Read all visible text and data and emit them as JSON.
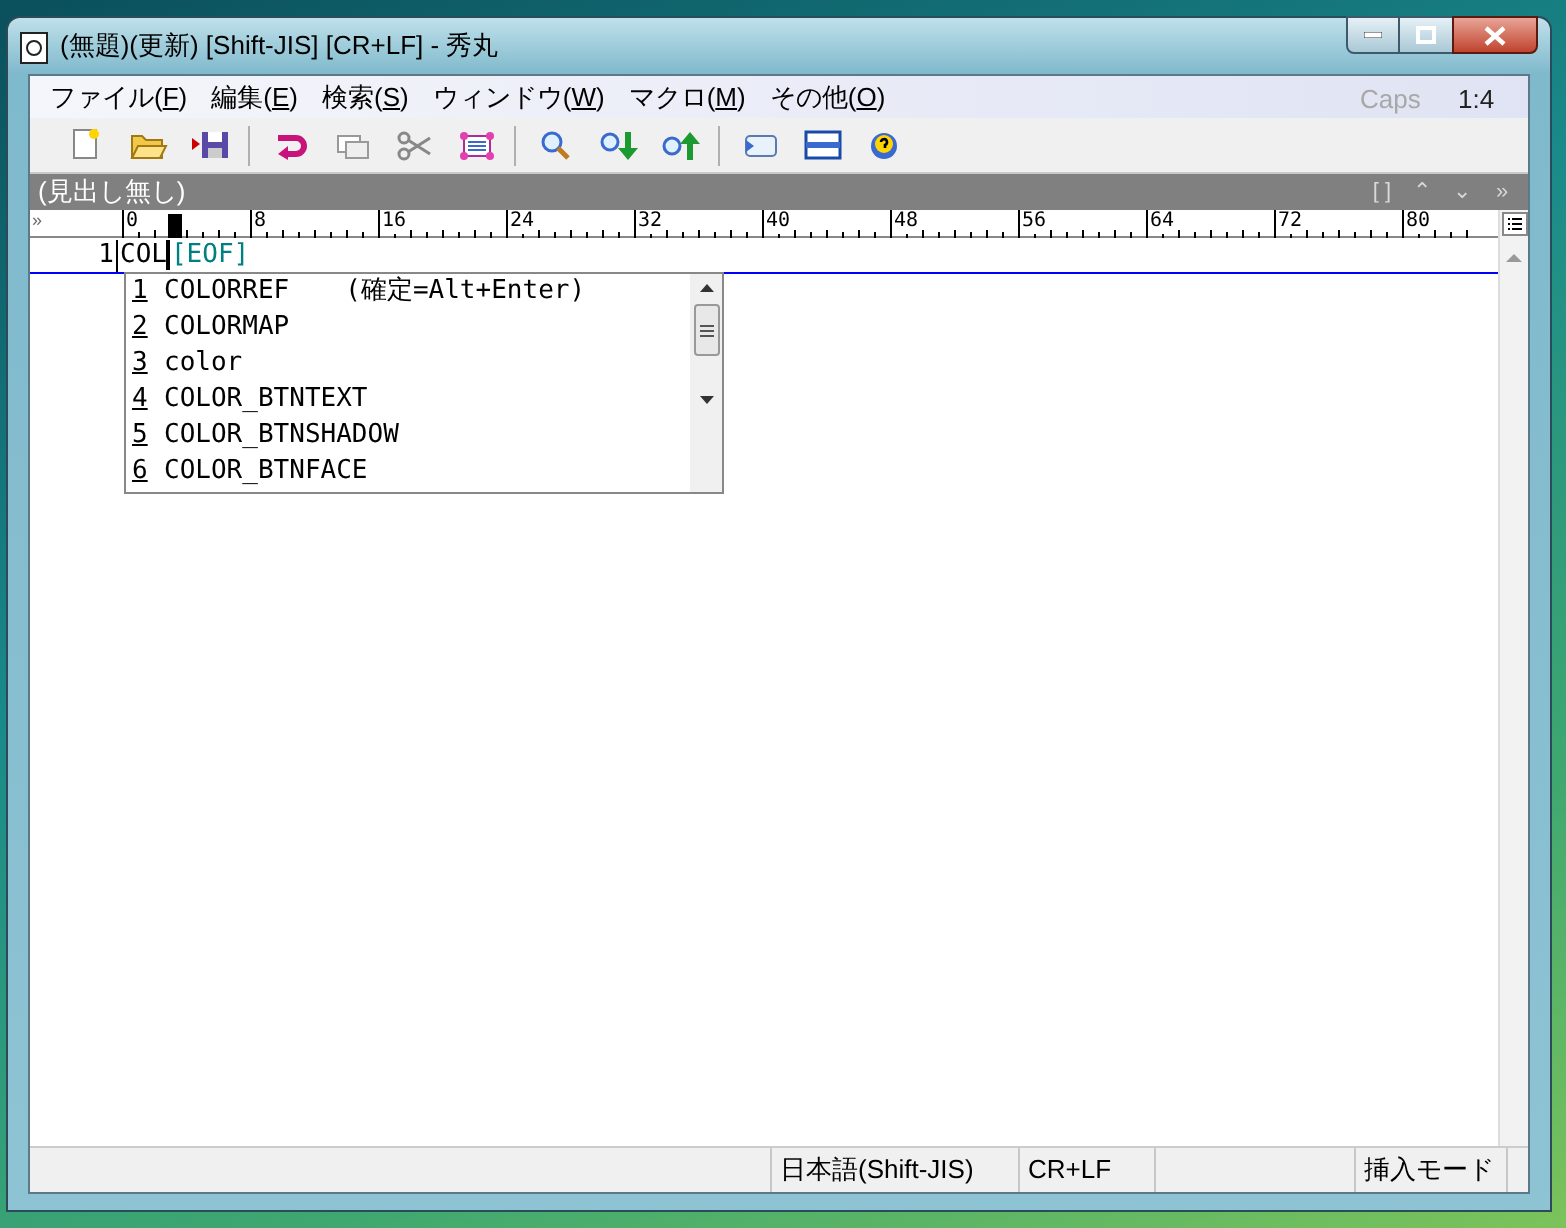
{
  "window": {
    "title": "(無題)(更新) [Shift-JIS] [CR+LF] - 秀丸"
  },
  "menu": [
    {
      "label": "ファイル(F)"
    },
    {
      "label": "編集(E)"
    },
    {
      "label": "検索(S)"
    },
    {
      "label": "ウィンドウ(W)"
    },
    {
      "label": "マクロ(M)"
    },
    {
      "label": "その他(O)"
    }
  ],
  "menu_status": {
    "caps": {
      "label": "Caps",
      "on": false
    },
    "position": "1:4"
  },
  "heading_bar": {
    "label": "(見出し無し)",
    "icons": [
      "[ ]",
      "⌃",
      "⌄",
      "»"
    ]
  },
  "ruler": {
    "ticks": [
      "0",
      "8",
      "16",
      "24",
      "32",
      "40",
      "48",
      "56",
      "64",
      "72",
      "80"
    ]
  },
  "editor": {
    "lines": [
      {
        "number": "1",
        "text": "COL",
        "eof": "[EOF]"
      }
    ]
  },
  "completion": {
    "items": [
      {
        "number": "1",
        "text": "COLORREF",
        "hint": "(確定=Alt+Enter)"
      },
      {
        "number": "2",
        "text": "COLORMAP"
      },
      {
        "number": "3",
        "text": "color"
      },
      {
        "number": "4",
        "text": "COLOR_BTNTEXT"
      },
      {
        "number": "5",
        "text": "COLOR_BTNSHADOW"
      },
      {
        "number": "6",
        "text": "COLOR_BTNFACE"
      }
    ]
  },
  "status_bar": [
    {
      "text": "日本語(Shift-JIS)"
    },
    {
      "text": "CR+LF"
    },
    {
      "text": "挿入モード"
    }
  ]
}
